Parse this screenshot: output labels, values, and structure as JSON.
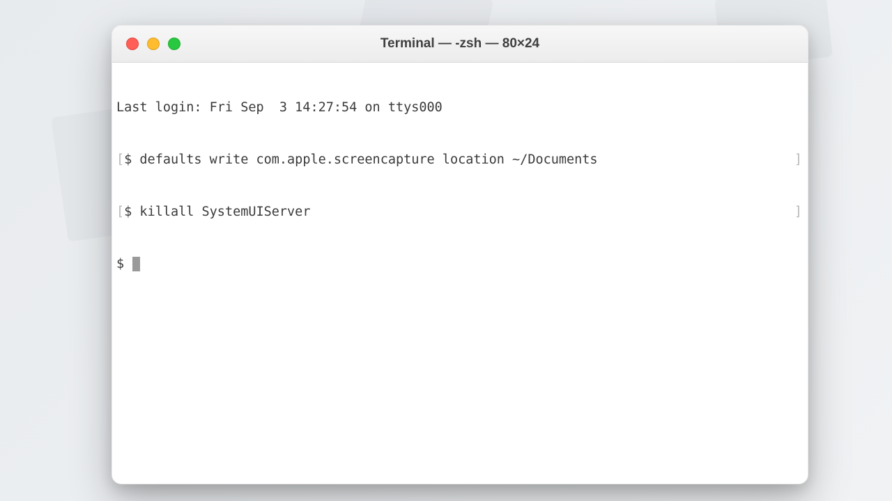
{
  "window": {
    "title": "Terminal — -zsh — 80×24"
  },
  "terminal": {
    "login_line": "Last login: Fri Sep  3 14:27:54 on ttys000",
    "prompt": "$",
    "bracket_open": "[",
    "bracket_close": "]",
    "lines": [
      "defaults write com.apple.screencapture location ~/Documents",
      "killall SystemUIServer"
    ]
  }
}
